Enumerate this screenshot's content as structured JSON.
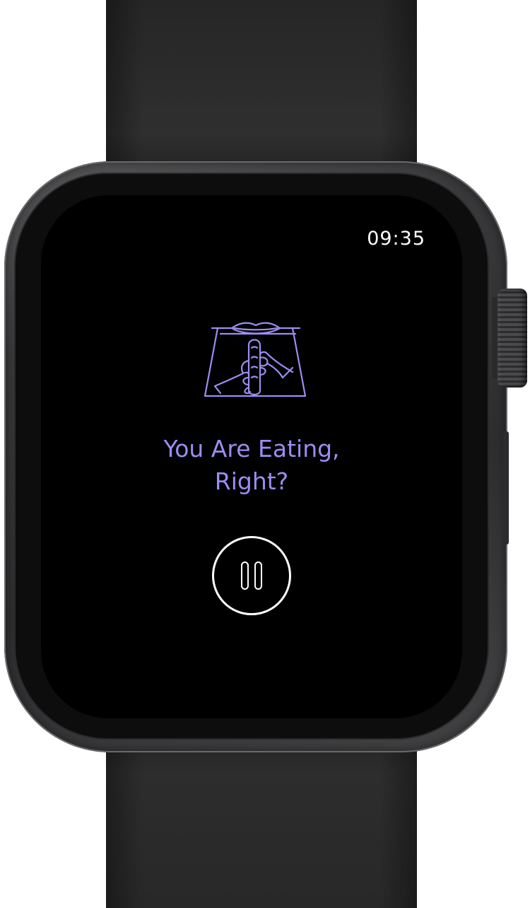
{
  "watch": {
    "time": "09:35",
    "message_line1": "You Are Eating,",
    "message_line2": "Right?",
    "illustration_icon": "hands-holding-food-icon",
    "pause_icon": "pause-icon",
    "accent_color": "#9d8cf2",
    "screen_color": "#000000",
    "text_color": "#ffffff"
  }
}
